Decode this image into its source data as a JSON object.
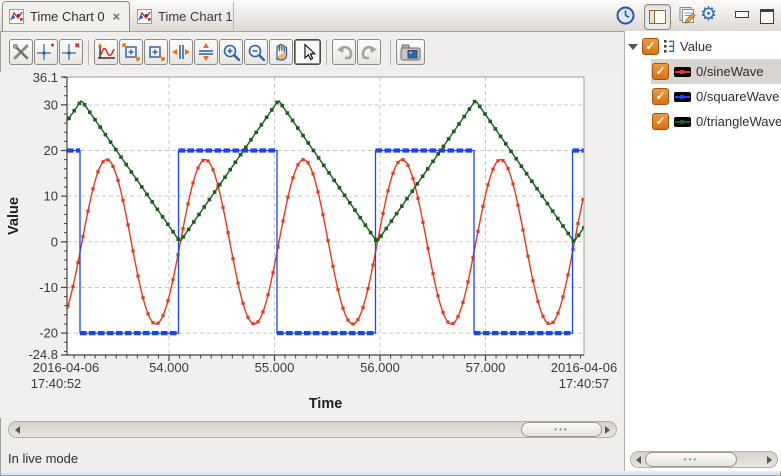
{
  "tabs": [
    {
      "label": "Time Chart 0",
      "active": true,
      "close_glyph": "×"
    },
    {
      "label": "Time Chart 1",
      "active": false
    }
  ],
  "header_icons": [
    "clock",
    "split-pane",
    "export-snapshot",
    "settings-gear",
    "minimize",
    "maximize"
  ],
  "toolbar": {
    "buttons": [
      "configure-settings",
      "add-annotation",
      "remove-annotation",
      "perform-auto-scale",
      "rubberband-zoom",
      "horizontal-rubberband-zoom",
      "zoom-horizontally",
      "zoom-vertically",
      "zoom-in",
      "zoom-out",
      "panning",
      "none-pointer",
      "undo",
      "redo",
      "save-snapshot"
    ]
  },
  "chart_data": {
    "type": "line",
    "xlabel": "Time",
    "ylabel": "Value",
    "x_axis": {
      "start_label_lines": [
        "2016-04-06",
        "17:40:52"
      ],
      "end_label_lines": [
        "2016-04-06",
        "17:40:57"
      ],
      "ticks": [
        {
          "t": 54,
          "label": "54.000"
        },
        {
          "t": 55,
          "label": "55.000"
        },
        {
          "t": 56,
          "label": "56.000"
        },
        {
          "t": 57,
          "label": "57.000"
        }
      ]
    },
    "y_axis": {
      "max": 36.1,
      "max_label": "36.1",
      "min": -24.8,
      "min_label": "-24.8",
      "ticks": [
        {
          "value": 30,
          "label": "30"
        },
        {
          "value": 20,
          "label": "20"
        },
        {
          "value": 10,
          "label": "10"
        },
        {
          "value": 0,
          "label": "0"
        },
        {
          "value": -10,
          "label": "-10"
        },
        {
          "value": -20,
          "label": "-20"
        }
      ]
    },
    "grid": true,
    "series": [
      {
        "name": "0/sineWave",
        "wave": "sine",
        "color": "#e23a20",
        "amplitude": 18,
        "offset": 0,
        "period_s": 1,
        "marker": "square"
      },
      {
        "name": "0/squareWave",
        "wave": "square",
        "color": "#1a46ee",
        "high": 20,
        "low": -20,
        "period_s": 2,
        "marker": "square"
      },
      {
        "name": "0/triangleWave",
        "wave": "triangle",
        "color": "#1c5c1e",
        "min": 0,
        "max": 31,
        "period_s": 2,
        "marker": "square"
      }
    ]
  },
  "side_panel": {
    "check_glyph": "✓",
    "root": {
      "label": "Value",
      "checked": true
    },
    "items": [
      {
        "label": "0/sineWave",
        "color": "#e23a20",
        "checked": true,
        "selected": true
      },
      {
        "label": "0/squareWave",
        "color": "#1a46ee",
        "checked": true,
        "selected": false
      },
      {
        "label": "0/triangleWave",
        "color": "#1c5c1e",
        "checked": true,
        "selected": false
      }
    ]
  },
  "status_bar": {
    "text": "In live mode"
  }
}
